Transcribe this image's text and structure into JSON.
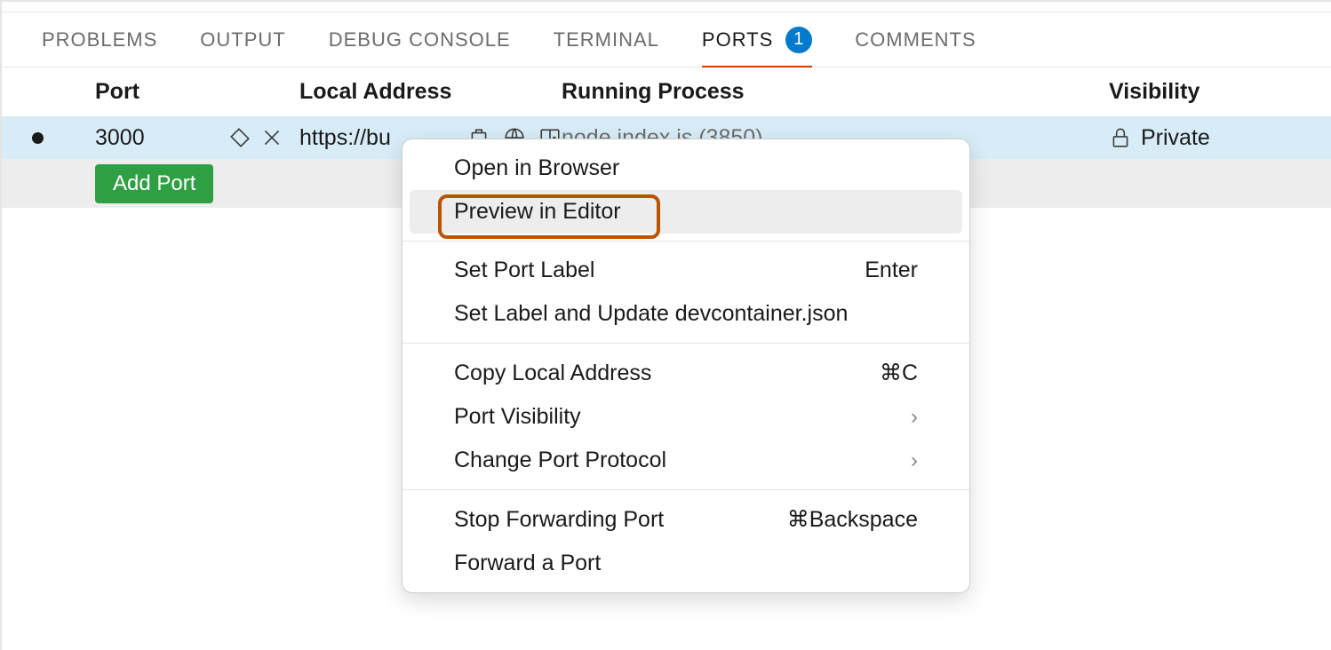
{
  "tabs": {
    "problems": "PROBLEMS",
    "output": "OUTPUT",
    "debug_console": "DEBUG CONSOLE",
    "terminal": "TERMINAL",
    "ports": "PORTS",
    "ports_badge": "1",
    "comments": "COMMENTS"
  },
  "table": {
    "headers": {
      "port": "Port",
      "local_address": "Local Address",
      "running_process": "Running Process",
      "visibility": "Visibility"
    },
    "row": {
      "port": "3000",
      "local_address": "https://bu",
      "running_process": "node index.js (3850)",
      "visibility": "Private"
    },
    "add_port_label": "Add Port"
  },
  "context_menu": {
    "open_in_browser": "Open in Browser",
    "preview_in_editor": "Preview in Editor",
    "set_port_label": "Set Port Label",
    "set_port_label_shortcut": "Enter",
    "set_label_update": "Set Label and Update devcontainer.json",
    "copy_local_address": "Copy Local Address",
    "copy_local_address_shortcut": "⌘C",
    "port_visibility": "Port Visibility",
    "change_port_protocol": "Change Port Protocol",
    "stop_forwarding_port": "Stop Forwarding Port",
    "stop_forwarding_port_shortcut": "⌘Backspace",
    "forward_a_port": "Forward a Port"
  }
}
